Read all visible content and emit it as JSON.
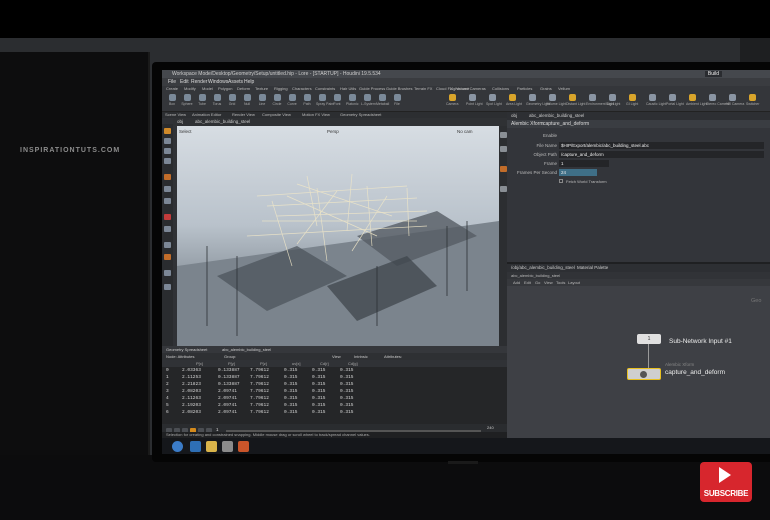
{
  "watermark": "INSPIRATIONTUTS.COM",
  "window": {
    "title": "Workspace Mode/Desktop/Geometry/Setup/untitled.hip - Lore - [STARTUP] - Houdini 19.5.534",
    "workspace_selector": "Build"
  },
  "menubar": [
    "File",
    "Edit",
    "Render",
    "Windows",
    "Assets",
    "Help"
  ],
  "shelf": {
    "tabs": [
      "Create",
      "Modify",
      "Model",
      "Polygon",
      "Deform",
      "Texture",
      "Rigging",
      "Characters",
      "Constraints",
      "Hair Utils",
      "Guide Process",
      "Guide Brushes",
      "Terrain FX",
      "Cloud FX",
      "Volume"
    ],
    "tools": [
      "Box",
      "Sphere",
      "Tube",
      "Torus",
      "Grid",
      "Null",
      "Line",
      "Circle",
      "Curve",
      "Path",
      "Spray Paint",
      "Font",
      "Platonic",
      "L-System",
      "Metaball",
      "File"
    ],
    "right_tabs": [
      "Lights and Cameras",
      "Collisions",
      "Particles",
      "Grains",
      "Vellum"
    ],
    "right_tools": [
      "Camera",
      "Point Light",
      "Spot Light",
      "Area Light",
      "Geometry Light",
      "Volume Light",
      "Distant Light",
      "Environment Light",
      "Sky Light",
      "GI Light",
      "Caustic Light",
      "Portal Light",
      "Ambient Light",
      "Stereo Camera",
      "VR Camera",
      "Switcher"
    ]
  },
  "pane_tabs": [
    "Scene View",
    "Animation Editor",
    "Render View",
    "Composite View",
    "Motion FX View",
    "Geometry Spreadsheet"
  ],
  "viewport": {
    "path": "obj",
    "node": "abc_alembic_building_steel",
    "mode": "Select",
    "top_label": "Persp",
    "camera": "No cam"
  },
  "spreadsheet": {
    "tab": "Geometry Spreadsheet",
    "node": "abc_alembic_building_steel",
    "mode": "Node: Attributes",
    "group": "Group:",
    "view": "View",
    "intrinsic": "Intrinsic",
    "attributes": "Attributes:",
    "columns": [
      "",
      "P[x]",
      "P[y]",
      "P[z]",
      "uv[x]",
      "Cd[r]",
      "Cd[g]"
    ],
    "rows": [
      [
        "0",
        "2.03363",
        "0.133887",
        "7.79612",
        "0.315",
        "0.315",
        "0.315"
      ],
      [
        "1",
        "2.11253",
        "0.133887",
        "7.79612",
        "0.315",
        "0.315",
        "0.315"
      ],
      [
        "2",
        "2.21823",
        "0.133887",
        "7.79612",
        "0.315",
        "0.315",
        "0.315"
      ],
      [
        "3",
        "2.08203",
        "2.09741",
        "7.79612",
        "0.315",
        "0.315",
        "0.315"
      ],
      [
        "4",
        "2.11263",
        "2.09741",
        "7.79612",
        "0.315",
        "0.315",
        "0.315"
      ],
      [
        "5",
        "2.19203",
        "2.09741",
        "7.79612",
        "0.315",
        "0.315",
        "0.315"
      ],
      [
        "6",
        "2.08203",
        "2.09741",
        "7.79612",
        "0.315",
        "0.315",
        "0.315"
      ]
    ]
  },
  "timeline": {
    "frame": "1",
    "start": "1",
    "end": "240",
    "end_range": "240"
  },
  "status": "Selection for creating and constrained snapping. Middle mouse drag or scroll wheel to track/spread channel values.",
  "parameters": {
    "header_tab": "abc_alembic_building_steel",
    "path": "obj",
    "node_type": "Alembic Xform",
    "node_name": "capture_and_deform",
    "fields": [
      {
        "label": "Enable",
        "value": ""
      },
      {
        "label": "File Name",
        "value": "$HIP/Export/alembic/abc_building_steel.abc"
      },
      {
        "label": "Object Path",
        "value": "/capture_and_deform"
      },
      {
        "label": "Frame",
        "value": "1"
      },
      {
        "label": "Frames Per Second",
        "value": "24"
      }
    ],
    "checkbox": "Fetch World Transform"
  },
  "network": {
    "tabs": [
      "/obj/abc_alembic_building_steel",
      "Material Palette"
    ],
    "path": "abc_alembic_building_steel",
    "menu": [
      "Add",
      "Edit",
      "Go",
      "View",
      "Tools",
      "Layout"
    ],
    "input_node_label": "1",
    "input_node_name": "Sub-Network Input #1",
    "capture_type": "Alembic Xform",
    "capture_name": "capture_and_deform",
    "right_edge_label": "Geo"
  },
  "youtube": {
    "label": "SUBSCRIBE",
    "color": "#d7262d"
  },
  "accent": "#d48a1c"
}
